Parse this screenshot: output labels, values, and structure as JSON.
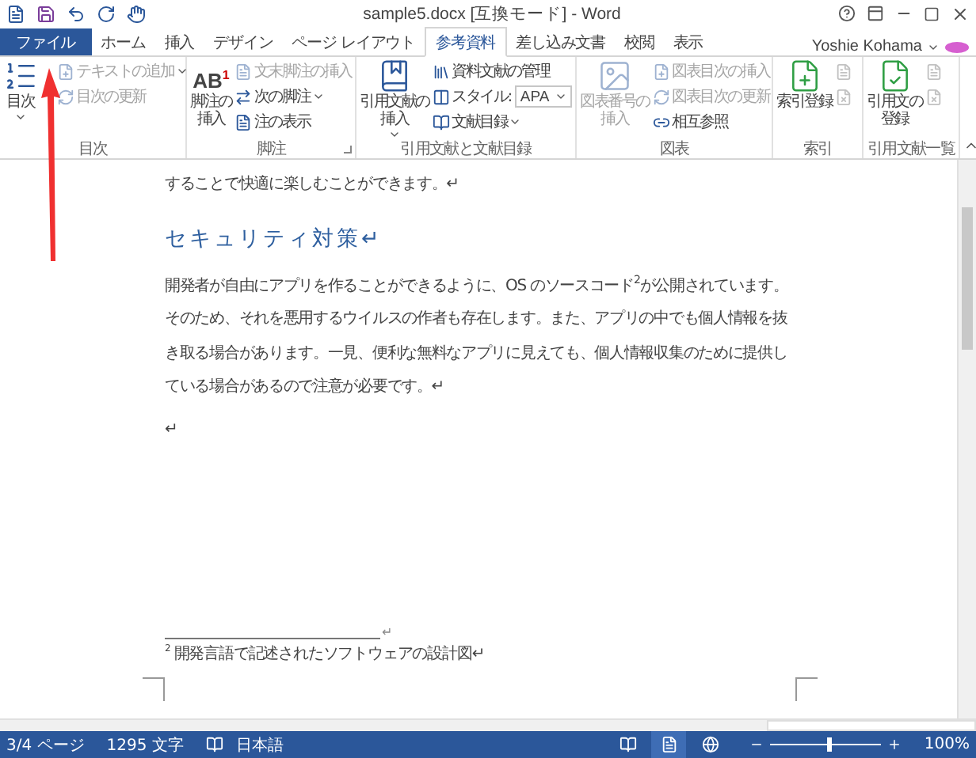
{
  "window": {
    "title": "sample5.docx [互換モード] - Word"
  },
  "tabs": [
    {
      "label": "ファイル",
      "kind": "file",
      "selected": false
    },
    {
      "label": "ホーム",
      "kind": "tab",
      "selected": false
    },
    {
      "label": "挿入",
      "kind": "tab",
      "selected": false
    },
    {
      "label": "デザイン",
      "kind": "tab",
      "selected": false
    },
    {
      "label": "ページ レイアウト",
      "kind": "tab",
      "selected": false
    },
    {
      "label": "参考資料",
      "kind": "tab",
      "selected": true
    },
    {
      "label": "差し込み文書",
      "kind": "tab",
      "selected": false
    },
    {
      "label": "校閲",
      "kind": "tab",
      "selected": false
    },
    {
      "label": "表示",
      "kind": "tab",
      "selected": false
    }
  ],
  "user": {
    "name": "Yoshie Kohama"
  },
  "ribbon": {
    "groups": [
      {
        "label": "目次",
        "launcher": false,
        "large": [
          {
            "lines": [
              "目次"
            ],
            "disabled": false,
            "dropdown": true
          }
        ],
        "small": [
          {
            "kind": "button",
            "label": "テキストの追加",
            "disabled": true,
            "dropdown": true
          },
          {
            "kind": "button",
            "label": "目次の更新",
            "disabled": true,
            "dropdown": false
          }
        ]
      },
      {
        "label": "脚注",
        "launcher": true,
        "large": [
          {
            "lines": [
              "脚注の",
              "挿入"
            ],
            "icon_text": "AB$^{1}$",
            "disabled": false,
            "dropdown": false
          }
        ],
        "small": [
          {
            "kind": "button",
            "label": "文末脚注の挿入",
            "disabled": true,
            "dropdown": false
          },
          {
            "kind": "button",
            "label": "次の脚注",
            "disabled": false,
            "dropdown": true
          },
          {
            "kind": "button",
            "label": "注の表示",
            "disabled": false,
            "dropdown": false
          }
        ]
      },
      {
        "label": "引用文献と文献目録",
        "launcher": false,
        "large": [
          {
            "lines": [
              "引用文献の",
              "挿入"
            ],
            "disabled": false,
            "dropdown": true
          }
        ],
        "small": [
          {
            "kind": "button",
            "label": "資料文献の管理",
            "disabled": false,
            "dropdown": false
          },
          {
            "kind": "select",
            "label": "スタイル:",
            "value": "APA",
            "disabled": false,
            "dropdown": true
          },
          {
            "kind": "button",
            "label": "文献目録",
            "disabled": false,
            "dropdown": true
          }
        ]
      },
      {
        "label": "図表",
        "launcher": false,
        "large": [
          {
            "lines": [
              "図表番号の",
              "挿入"
            ],
            "disabled": true,
            "dropdown": false
          }
        ],
        "small": [
          {
            "kind": "button",
            "label": "図表目次の挿入",
            "disabled": true,
            "dropdown": false
          },
          {
            "kind": "button",
            "label": "図表目次の更新",
            "disabled": true,
            "dropdown": false
          },
          {
            "kind": "button",
            "label": "相互参照",
            "disabled": false,
            "dropdown": false
          }
        ]
      },
      {
        "label": "索引",
        "launcher": false,
        "large": [
          {
            "lines": [
              "索引登録"
            ],
            "disabled": false,
            "dropdown": false
          }
        ],
        "small": [
          {
            "kind": "icon",
            "disabled": true
          },
          {
            "kind": "icon",
            "disabled": true
          }
        ]
      },
      {
        "label": "引用文献一覧",
        "launcher": false,
        "large": [
          {
            "lines": [
              "引用文の",
              "登録"
            ],
            "disabled": false,
            "dropdown": false
          }
        ],
        "small": [
          {
            "kind": "icon",
            "disabled": true
          },
          {
            "kind": "icon",
            "disabled": true
          }
        ]
      }
    ]
  },
  "document": {
    "paragraphs": [
      {
        "kind": "body",
        "text": "することで快適に楽しむことができます。↵"
      },
      {
        "kind": "heading",
        "text": "セキュリティ対策↵"
      },
      {
        "kind": "body",
        "text": "開発者が自由にアプリを作ることができるように、OS のソースコード$^{2}$が公開されています。そのため、それを悪用するウイルスの作者も存在します。また、アプリの中でも個人情報を抜き取る場合があります。一見、便利な無料なアプリに見えても、個人情報収集のために提供している場合があるので注意が必要です。↵"
      },
      {
        "kind": "body",
        "text": "↵"
      }
    ],
    "footnote": {
      "separator_mark": "↵",
      "mark": "2",
      "text": "開発言語で記述されたソフトウェアの設計図↵"
    }
  },
  "status_bar": {
    "page": "3/4 ページ",
    "words": "1295 文字",
    "language": "日本語",
    "views": [
      {
        "selected": false
      },
      {
        "selected": true
      },
      {
        "selected": false
      }
    ],
    "zoom": {
      "level": 0.52,
      "reading": "100%"
    }
  }
}
